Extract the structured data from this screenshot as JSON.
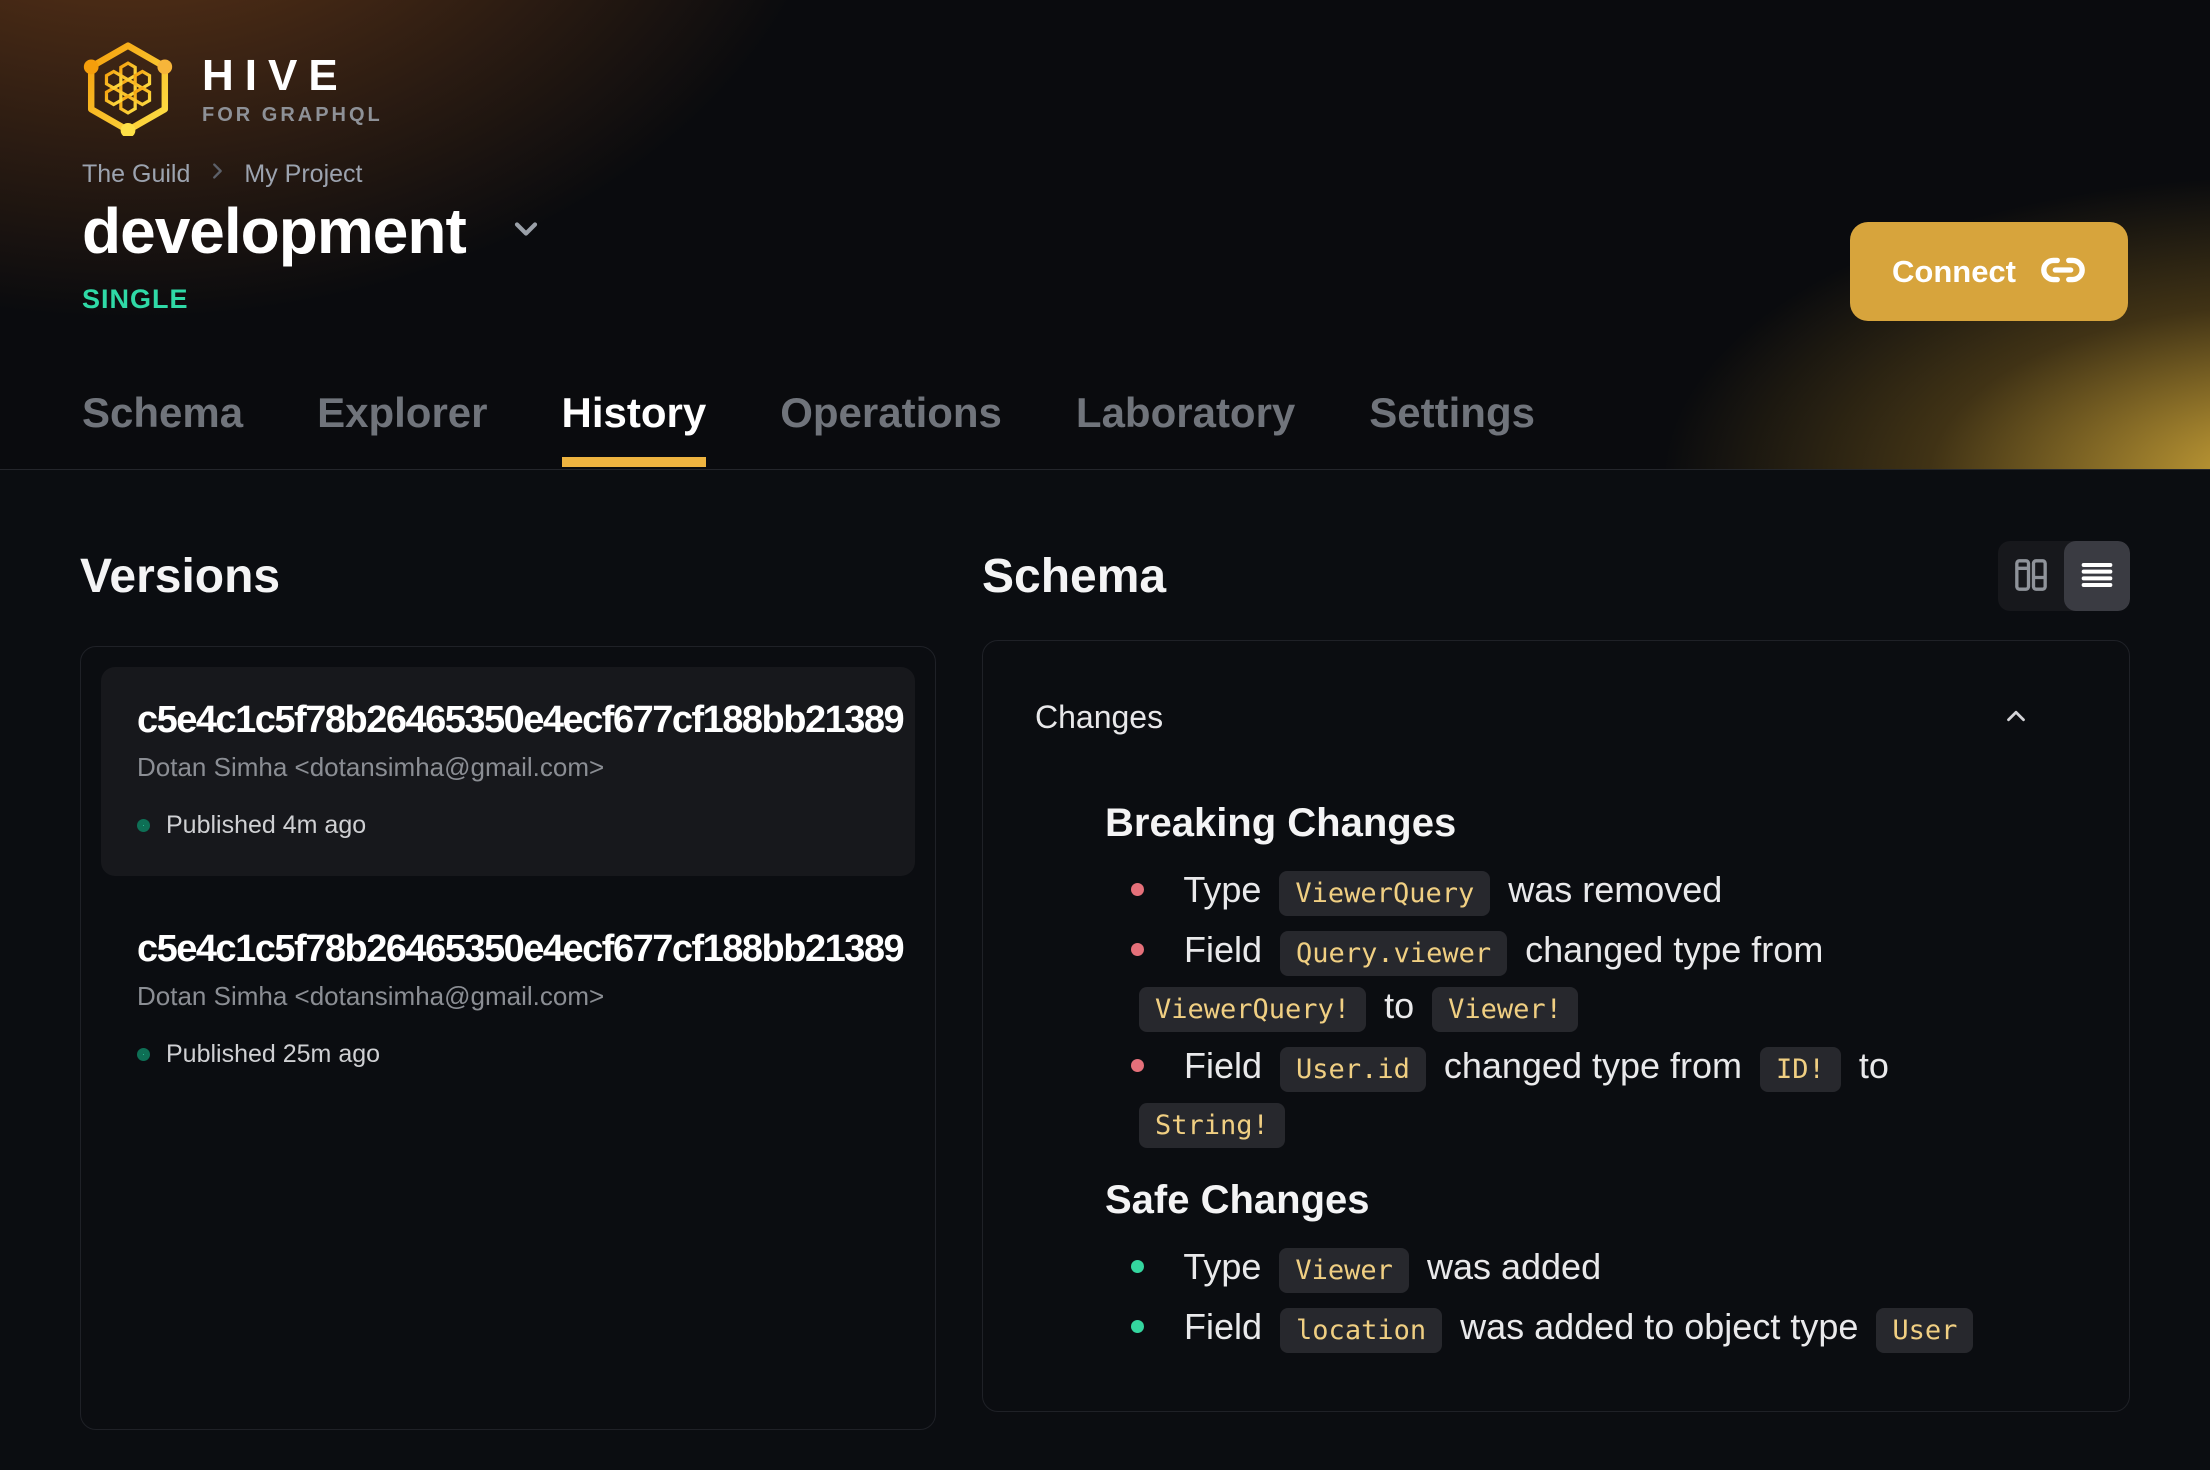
{
  "brand": {
    "name": "HIVE",
    "tagline": "FOR GRAPHQL"
  },
  "breadcrumb": [
    "The Guild",
    "My Project"
  ],
  "project": {
    "name": "development",
    "badge": "SINGLE"
  },
  "connect": {
    "label": "Connect"
  },
  "tabs": [
    {
      "label": "Schema",
      "active": false
    },
    {
      "label": "Explorer",
      "active": false
    },
    {
      "label": "History",
      "active": true
    },
    {
      "label": "Operations",
      "active": false
    },
    {
      "label": "Laboratory",
      "active": false
    },
    {
      "label": "Settings",
      "active": false
    }
  ],
  "versions": {
    "title": "Versions",
    "items": [
      {
        "hash": "c5e4c1c5f78b26465350e4ecf677cf188bb21389",
        "author": "Dotan Simha <dotansimha@gmail.com>",
        "status": "Published 4m ago",
        "selected": true
      },
      {
        "hash": "c5e4c1c5f78b26465350e4ecf677cf188bb21389",
        "author": "Dotan Simha <dotansimha@gmail.com>",
        "status": "Published 25m ago",
        "selected": false
      }
    ]
  },
  "schema": {
    "title": "Schema",
    "view_toggle": {
      "options": [
        "split-view",
        "list-view"
      ],
      "selected": "list-view"
    },
    "changes": {
      "label": "Changes",
      "collapsed": false,
      "groups": [
        {
          "title": "Breaking Changes",
          "kind": "breaking",
          "items": [
            [
              {
                "text": "Type"
              },
              {
                "code": "ViewerQuery"
              },
              {
                "text": "was removed"
              }
            ],
            [
              {
                "text": "Field"
              },
              {
                "code": "Query.viewer"
              },
              {
                "text": "changed type from"
              },
              {
                "code": "ViewerQuery!"
              },
              {
                "text": "to"
              },
              {
                "code": "Viewer!"
              }
            ],
            [
              {
                "text": "Field"
              },
              {
                "code": "User.id"
              },
              {
                "text": "changed type from"
              },
              {
                "code": "ID!"
              },
              {
                "text": "to"
              },
              {
                "code": "String!"
              }
            ]
          ]
        },
        {
          "title": "Safe Changes",
          "kind": "safe",
          "items": [
            [
              {
                "text": "Type"
              },
              {
                "code": "Viewer"
              },
              {
                "text": "was added"
              }
            ],
            [
              {
                "text": "Field"
              },
              {
                "code": "location"
              },
              {
                "text": "was added to object type"
              },
              {
                "code": "User"
              }
            ]
          ]
        }
      ]
    }
  },
  "colors": {
    "accent": "#d7a43c",
    "tab_underline": "#eeb440",
    "badge_green": "#2fd9a6",
    "breaking_bullet": "#e5707a",
    "safe_bullet": "#34d69f",
    "chip_text": "#f0cf82",
    "chip_bg": "#27282d"
  }
}
